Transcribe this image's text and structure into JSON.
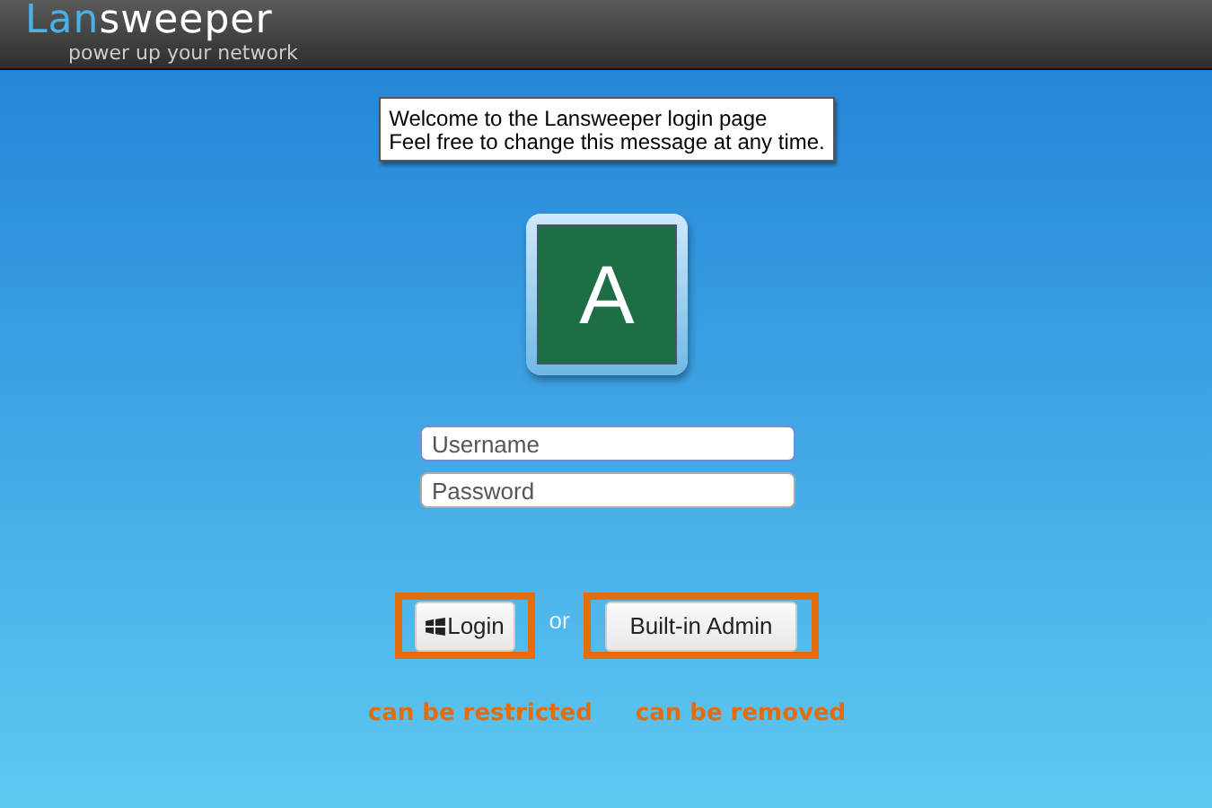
{
  "header": {
    "logo": {
      "part_1": "Lan",
      "part_2": "sweeper"
    },
    "tagline": "power up your network"
  },
  "message": [
    "Welcome to the Lansweeper login page",
    "Feel free to change this message at any time."
  ],
  "avatar": {
    "letter": "A"
  },
  "fields": [
    {
      "placeholder": "Username",
      "focused": true
    },
    {
      "placeholder": "Password",
      "focused": false
    }
  ],
  "login_button": {
    "label": "Login"
  },
  "separator": "or",
  "admin_button": {
    "label": "Built-in Admin"
  },
  "annotations": [
    "can be restricted",
    "can be removed"
  ]
}
